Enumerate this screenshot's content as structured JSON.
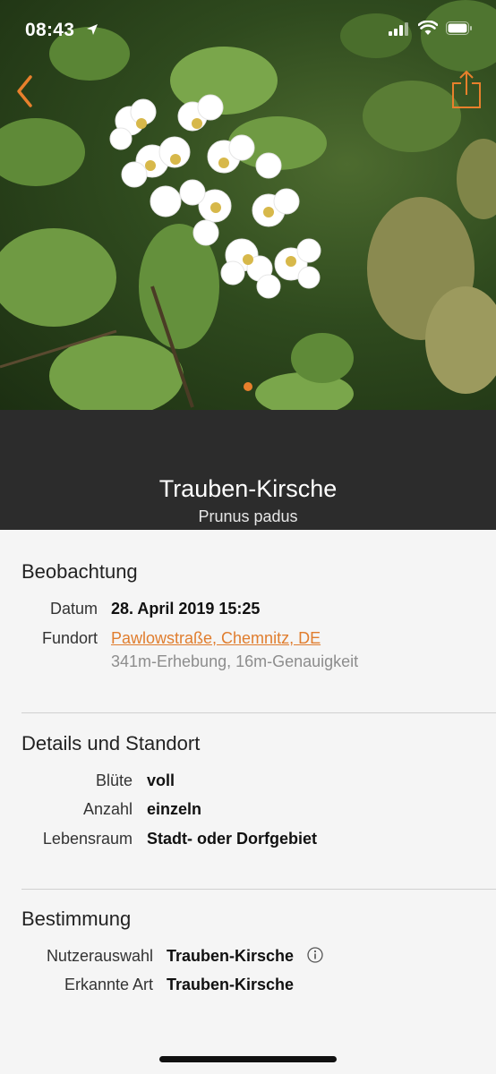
{
  "status_bar": {
    "time": "08:43"
  },
  "header": {
    "common_name": "Trauben-Kirsche",
    "latin_name": "Prunus padus"
  },
  "observation": {
    "title": "Beobachtung",
    "date_label": "Datum",
    "date_value": "28. April 2019  15:25",
    "location_label": "Fundort",
    "location_value": "Pawlowstraße, Chemnitz, DE",
    "location_detail": "341m-Erhebung, 16m-Genauigkeit"
  },
  "details": {
    "title": "Details und Standort",
    "rows": [
      {
        "label": "Blüte",
        "value": "voll"
      },
      {
        "label": "Anzahl",
        "value": "einzeln"
      },
      {
        "label": "Lebensraum",
        "value": "Stadt- oder Dorfgebiet"
      }
    ]
  },
  "identification": {
    "title": "Bestimmung",
    "rows": [
      {
        "label": "Nutzerauswahl",
        "value": "Trauben-Kirsche"
      },
      {
        "label": "Erkannte Art",
        "value": "Trauben-Kirsche"
      }
    ]
  },
  "icons": {
    "back": "chevron-left-icon",
    "share": "share-icon",
    "info": "info-icon"
  },
  "colors": {
    "accent": "#e07d2e",
    "title_band": "#2c2c2c",
    "background": "#f5f5f5"
  }
}
